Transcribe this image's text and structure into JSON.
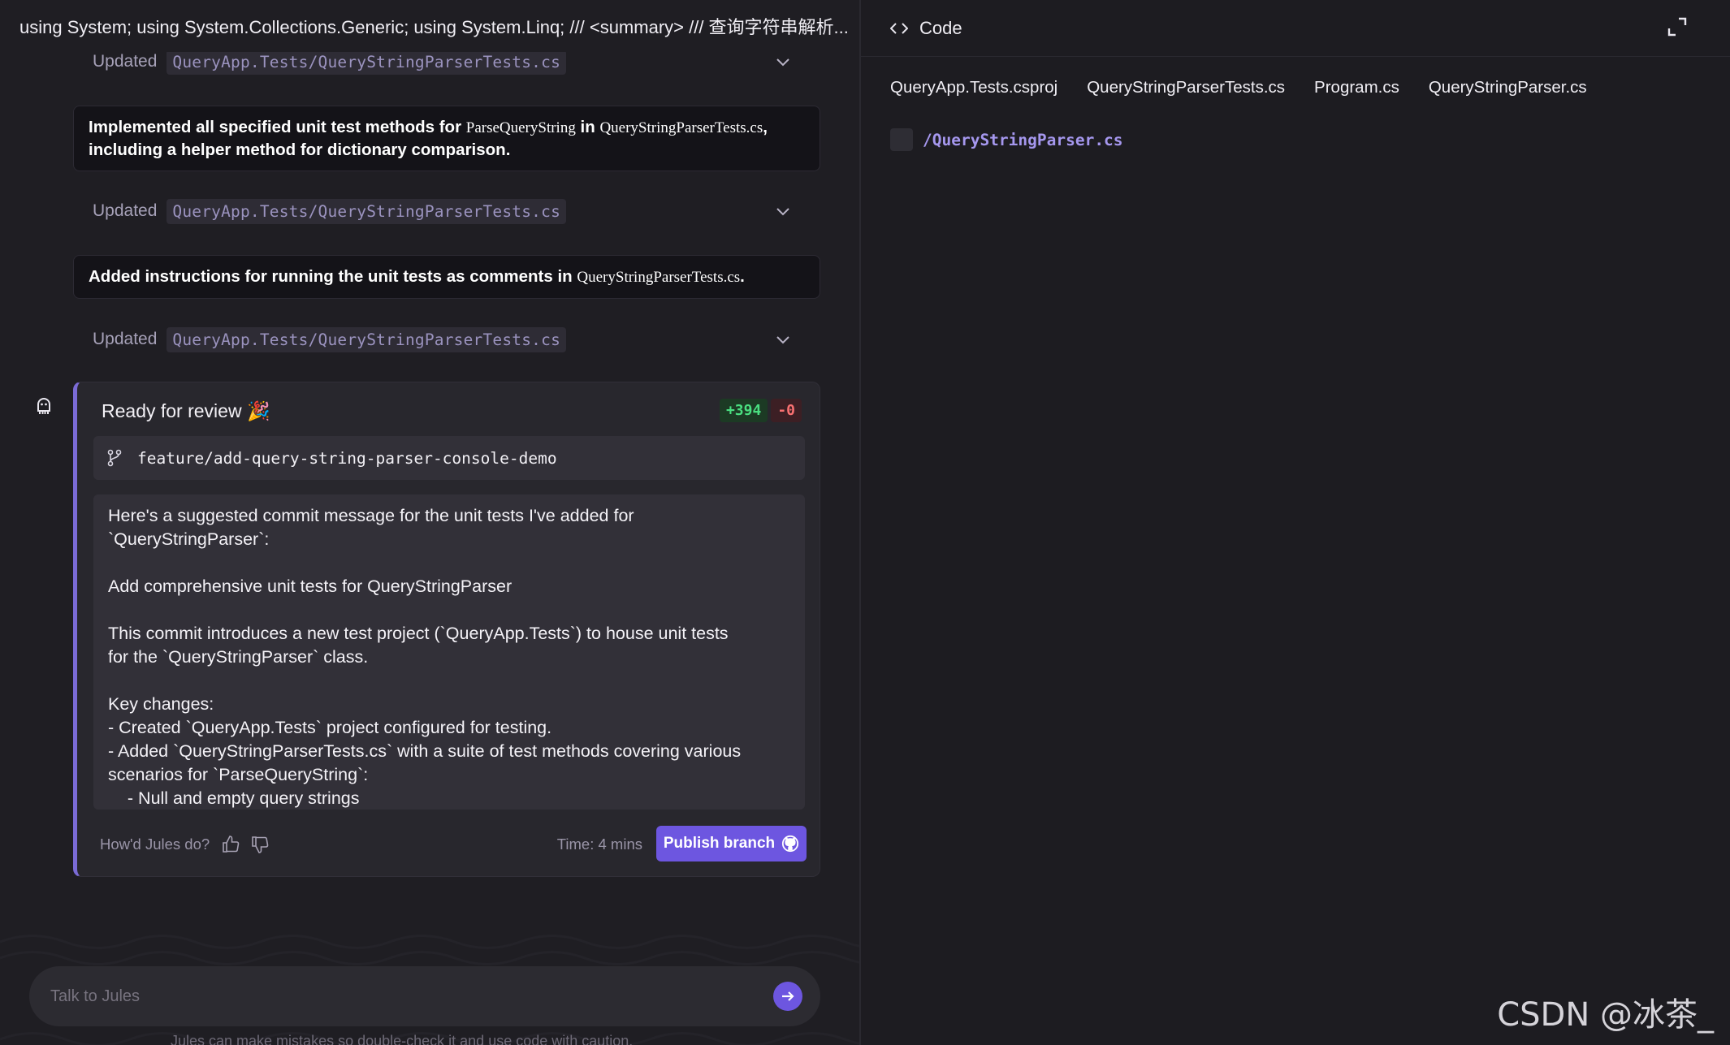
{
  "header": {
    "task_title": "using System; using System.Collections.Generic; using System.Linq; /// <summary> /// 查询字符串解析..."
  },
  "activity": [
    {
      "type": "updated",
      "label": "Updated",
      "path": "QueryApp.Tests/QueryStringParserTests.cs"
    },
    {
      "type": "summary",
      "parts": [
        "Implemented all specified unit test methods for ",
        "ParseQueryString",
        " in ",
        "QueryStringParserTests.cs",
        ",",
        "including a helper method for dictionary comparison."
      ]
    },
    {
      "type": "updated",
      "label": "Updated",
      "path": "QueryApp.Tests/QueryStringParserTests.cs"
    },
    {
      "type": "summary",
      "parts": [
        "Added instructions for running the unit tests as comments in ",
        "QueryStringParserTests.cs",
        "."
      ]
    },
    {
      "type": "updated",
      "label": "Updated",
      "path": "QueryApp.Tests/QueryStringParserTests.cs"
    }
  ],
  "review": {
    "title": "Ready for review",
    "emoji": "🎉",
    "additions": "+394",
    "deletions": "-0",
    "branch": "feature/add-query-string-parser-console-demo",
    "commit_message": "Here's a suggested commit message for the unit tests I've added for\n`QueryStringParser`:\n\nAdd comprehensive unit tests for QueryStringParser\n\nThis commit introduces a new test project (`QueryApp.Tests`) to house unit tests\nfor the `QueryStringParser` class.\n\nKey changes:\n- Created `QueryApp.Tests` project configured for testing.\n- Added `QueryStringParserTests.cs` with a suite of test methods covering various\nscenarios for `ParseQueryString`:\n    - Null and empty query strings",
    "feedback_prompt": "How'd Jules do?",
    "time": "Time: 4 mins",
    "publish_label": "Publish branch"
  },
  "chat": {
    "placeholder": "Talk to Jules",
    "disclaimer": "Jules can make mistakes so double-check it and use code with caution."
  },
  "code_panel": {
    "title": "Code",
    "tabs": [
      "QueryApp.Tests.csproj",
      "QueryStringParserTests.cs",
      "Program.cs",
      "QueryStringParser.cs"
    ],
    "file_path": "/QueryStringParser.cs"
  },
  "watermark": "CSDN @冰茶_",
  "colors": {
    "accent": "#6d56e0",
    "additions": "#4ade80",
    "deletions": "#f87171"
  }
}
